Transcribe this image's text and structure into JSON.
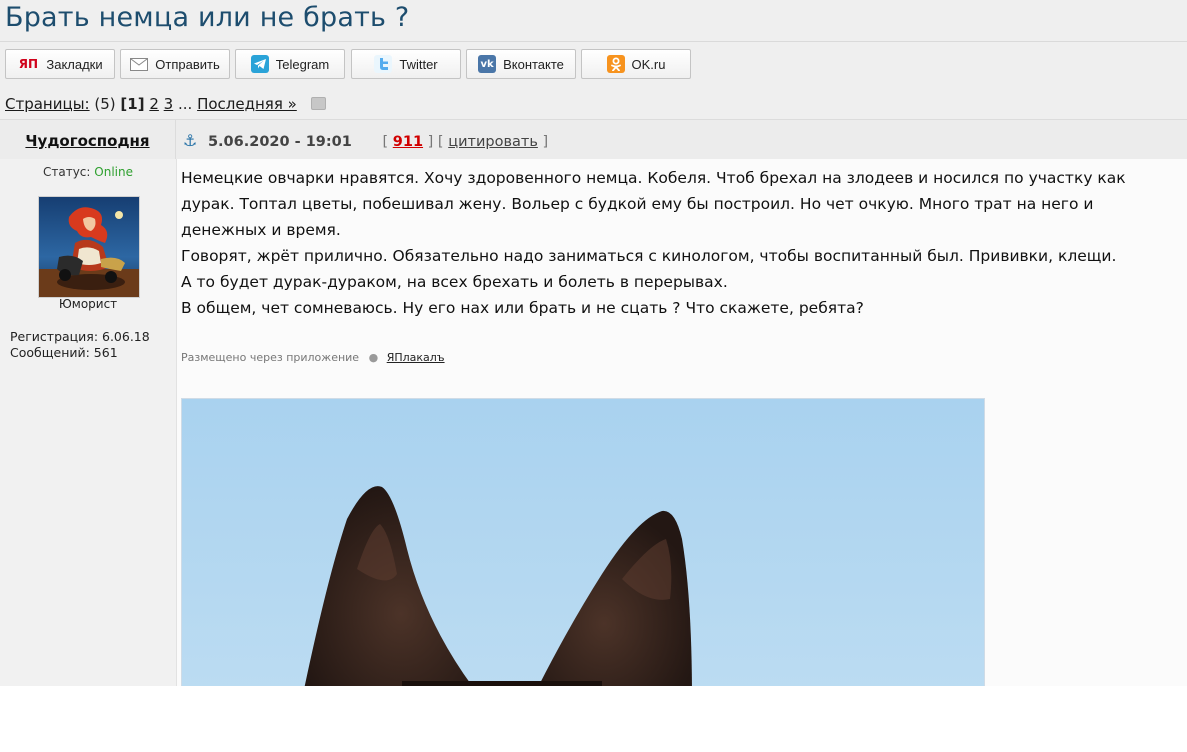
{
  "topic": {
    "title": "Брать немца или не брать ?"
  },
  "share": {
    "buttons": [
      {
        "label": "Закладки",
        "icon": "yap-icon"
      },
      {
        "label": "Отправить",
        "icon": "envelope-icon"
      },
      {
        "label": "Telegram",
        "icon": "telegram-icon"
      },
      {
        "label": "Twitter",
        "icon": "twitter-icon"
      },
      {
        "label": "Вконтакте",
        "icon": "vk-icon"
      },
      {
        "label": "OK.ru",
        "icon": "ok-icon"
      }
    ]
  },
  "pager": {
    "label": "Страницы:",
    "count": "(5)",
    "current": "[1]",
    "pages": [
      "2",
      "3"
    ],
    "ellipsis": "...",
    "last": "Последняя »"
  },
  "post": {
    "author": "Чудогосподня",
    "status_label": "Статус:",
    "status_value": "Online",
    "rank": "Юморист",
    "registration": "Регистрация: 6.06.18",
    "messages": "Сообщений: 561",
    "datetime": "5.06.2020 - 19:01",
    "score": "911",
    "quote_label": "цитировать",
    "paragraphs": [
      "Немецкие овчарки нравятся. Хочу здоровенного немца. Кобеля. Чтоб брехал на злодеев и носился по участку как дурак. Топтал цветы, побешивал жену. Вольер с будкой ему бы построил. Но чет очкую. Много трат на него и денежных и время.",
      "Говорят, жрёт прилично. Обязательно надо заниматься с кинологом, чтобы воспитанный был. Прививки, клещи.",
      "А то будет дурак-дураком, на всех брехать и болеть в перерывах.",
      "В общем, чет сомневаюсь. Ну его нах или брать и не сцать ? Что скажете, ребята?"
    ],
    "via_text": "Размещено через приложение",
    "via_app": "ЯПлакалъ"
  },
  "colors": {
    "title": "#1d4d6e",
    "online": "#2fa02f",
    "score": "#d10000",
    "anchor": "#2a74a8"
  }
}
